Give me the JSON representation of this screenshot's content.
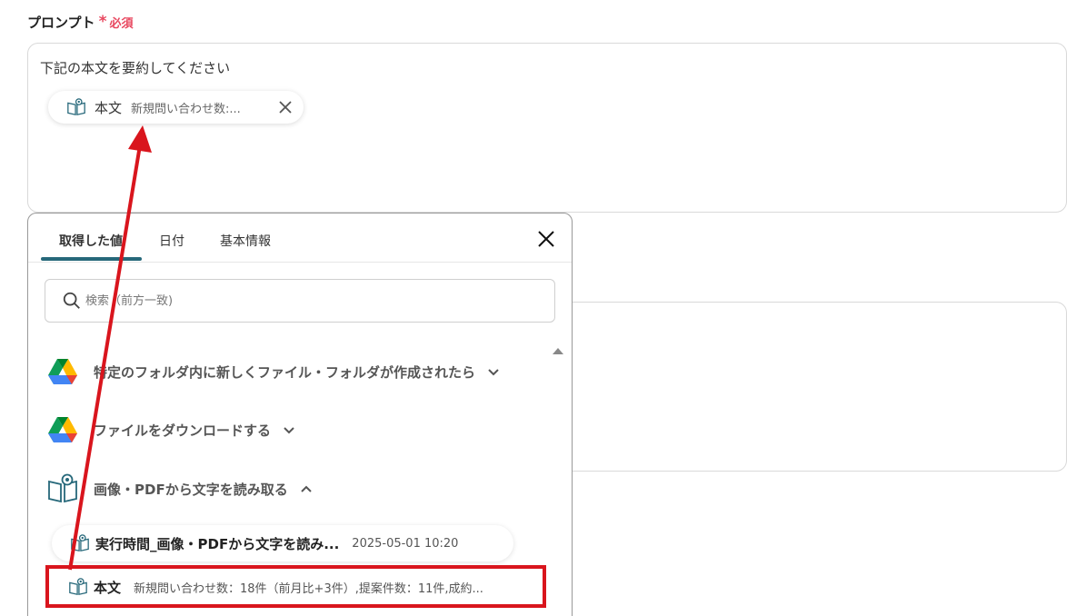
{
  "field": {
    "label": "プロンプト",
    "required_mark": "*",
    "required_text": "必須"
  },
  "prompt": {
    "text": "下記の本文を要約してください",
    "chip": {
      "name": "本文",
      "preview": "新規問い合わせ数:..."
    }
  },
  "popup": {
    "tabs": [
      {
        "label": "取得した値",
        "active": true
      },
      {
        "label": "日付",
        "active": false
      },
      {
        "label": "基本情報",
        "active": false
      }
    ],
    "search": {
      "placeholder": "検索（前方一致)"
    },
    "sources": [
      {
        "label": "特定のフォルダ内に新しくファイル・フォルダが作成されたら",
        "icon": "google-drive-icon",
        "expanded": false
      },
      {
        "label": "ファイルをダウンロードする",
        "icon": "google-drive-icon",
        "expanded": false
      },
      {
        "label": "画像・PDFから文字を読み取る",
        "icon": "ocr-book-icon",
        "expanded": true
      }
    ],
    "items": [
      {
        "name": "実行時間_画像・PDFから文字を読み...",
        "value": "2025-05-01 10:20"
      },
      {
        "name": "本文",
        "value": "新規問い合わせ数：18件（前月比+3件）,提案件数：11件,成約..."
      }
    ]
  },
  "colors": {
    "accent": "#26687a",
    "required": "#e8475f",
    "annotation": "#d9151d"
  }
}
